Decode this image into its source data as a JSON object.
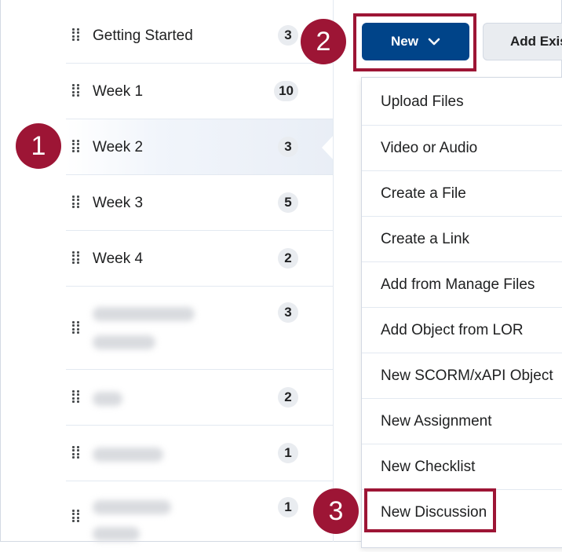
{
  "modules": [
    {
      "title": "Getting Started",
      "count": "3",
      "blurred": false,
      "active": false
    },
    {
      "title": "Week 1",
      "count": "10",
      "blurred": false,
      "active": false
    },
    {
      "title": "Week 2",
      "count": "3",
      "blurred": false,
      "active": true
    },
    {
      "title": "Week 3",
      "count": "5",
      "blurred": false,
      "active": false
    },
    {
      "title": "Week 4",
      "count": "2",
      "blurred": false,
      "active": false
    },
    {
      "title": "",
      "count": "3",
      "blurred": true,
      "active": false
    },
    {
      "title": "",
      "count": "2",
      "blurred": true,
      "active": false
    },
    {
      "title": "",
      "count": "1",
      "blurred": true,
      "active": false
    },
    {
      "title": "",
      "count": "1",
      "blurred": true,
      "active": false
    }
  ],
  "toolbar": {
    "new_label": "New",
    "new_icon": "chevron-down-icon",
    "add_existing_label": "Add Exis"
  },
  "menu": {
    "items": [
      "Upload Files",
      "Video or Audio",
      "Create a File",
      "Create a Link",
      "Add from Manage Files",
      "Add Object from LOR",
      "New SCORM/xAPI Object",
      "New Assignment",
      "New Checklist",
      "New Discussion"
    ]
  },
  "steps": [
    "1",
    "2",
    "3"
  ],
  "colors": {
    "primary": "#004489",
    "highlight": "#9d1535",
    "count_bg": "#e9ecf0"
  }
}
